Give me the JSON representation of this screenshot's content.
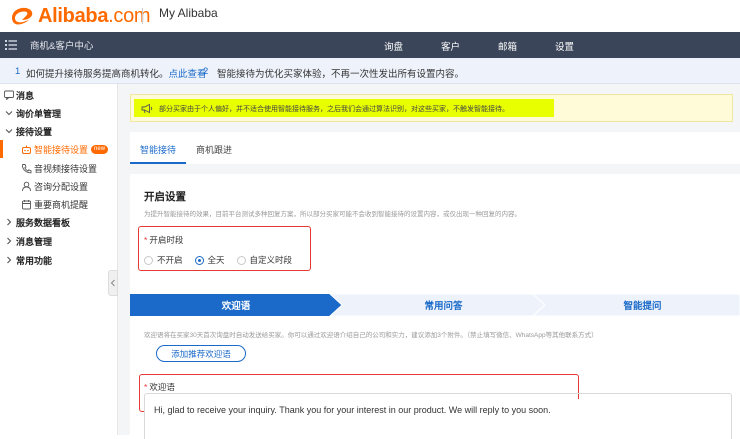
{
  "header": {
    "logo_text": "Alibaba",
    "logo_suffix": ".com",
    "app_name": "My Alibaba",
    "brand_color": "#ff6a00"
  },
  "navbar": {
    "section": "商机&客户中心",
    "items": [
      "询盘",
      "客户",
      "邮箱",
      "设置"
    ],
    "bg_color": "#3a4559"
  },
  "tips": {
    "tip1_num": "1",
    "tip1_text": "如何提升接待服务提高商机转化。",
    "tip1_link": "点此查看",
    "tip2_num": "2",
    "tip2_text": "智能接待为优化买家体验，不再一次性发出所有设置内容。"
  },
  "sidebar": {
    "groups": [
      {
        "label": "消息",
        "icon": "message-icon"
      },
      {
        "label": "询价单管理",
        "icon": "chevron-down-icon"
      },
      {
        "label": "接待设置",
        "icon": "chevron-down-icon"
      }
    ],
    "sub_items": [
      {
        "label": "智能接待设置",
        "icon": "robot-icon",
        "badge": "new",
        "active": true
      },
      {
        "label": "音视频接待设置",
        "icon": "phone-icon"
      },
      {
        "label": "咨询分配设置",
        "icon": "user-icon"
      },
      {
        "label": "重要商机提醒",
        "icon": "calendar-icon"
      }
    ],
    "tail_groups": [
      {
        "label": "服务数据看板"
      },
      {
        "label": "消息管理"
      },
      {
        "label": "常用功能"
      }
    ]
  },
  "notice": {
    "icon": "megaphone-icon",
    "text": "部分买家由于个人偏好，并不适合使用智能接待服务，之后我们会通过算法识别，对这些买家，不触发智能接待。"
  },
  "tabs": [
    {
      "label": "智能接待",
      "active": true
    },
    {
      "label": "商机跟进",
      "active": false
    }
  ],
  "settings": {
    "title": "开启设置",
    "description": "为提升智能接待的效果，目前平台测试多种回复方案，所以部分买家可能不会收到智能接待的设置内容，或仅出现一种回复的内容。",
    "period_label": "开启时段",
    "period_options": [
      "不开启",
      "全天",
      "自定义时段"
    ],
    "period_selected": "全天",
    "required_mark": "*"
  },
  "steps": [
    {
      "label": "欢迎语",
      "active": true
    },
    {
      "label": "常用问答",
      "active": false
    },
    {
      "label": "智能提问",
      "active": false
    }
  ],
  "welcome": {
    "description": "欢迎语将在买家30天首次询盘时自动发送给买家。你可以通过欢迎语介绍自己的公司和实力，建议添加3个附件。（禁止填写微信、WhatsApp等其他联系方式）",
    "recommend_button": "添加推荐欢迎语",
    "label": "欢迎语",
    "value": "Hi, glad to receive your inquiry. Thank you for your interest in our product. We will reply to you soon."
  },
  "colors": {
    "accent_blue": "#1b6ac9",
    "highlight_red": "#e53935",
    "notice_highlight": "#e8ff00"
  }
}
